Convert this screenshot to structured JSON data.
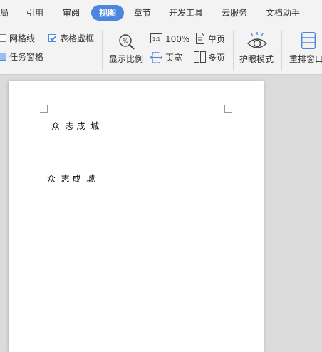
{
  "tabs": [
    "局",
    "引用",
    "审阅",
    "视图",
    "章节",
    "开发工具",
    "云服务",
    "文档助手"
  ],
  "active_tab": "视图",
  "ribbon": {
    "checkboxes": {
      "gridlines": {
        "label": "网格线",
        "checked": false
      },
      "table_gridlines": {
        "label": "表格虚框",
        "checked": true
      },
      "task_pane": {
        "label": "任务窗格",
        "checked": true
      }
    },
    "zoom_label": "显示比例",
    "zoom_100": "100%",
    "page_width": "页宽",
    "single_page": "单页",
    "multi_page": "多页",
    "eye_mode": "护眼模式",
    "rearrange_window": "重排窗口"
  },
  "document": {
    "line1": "众  志 成  城",
    "line2": "众  志 成  城"
  },
  "colors": {
    "accent": "#4d86dd",
    "ribbon_bg": "#f3f3f3",
    "canvas_bg": "#dbdbdb"
  }
}
